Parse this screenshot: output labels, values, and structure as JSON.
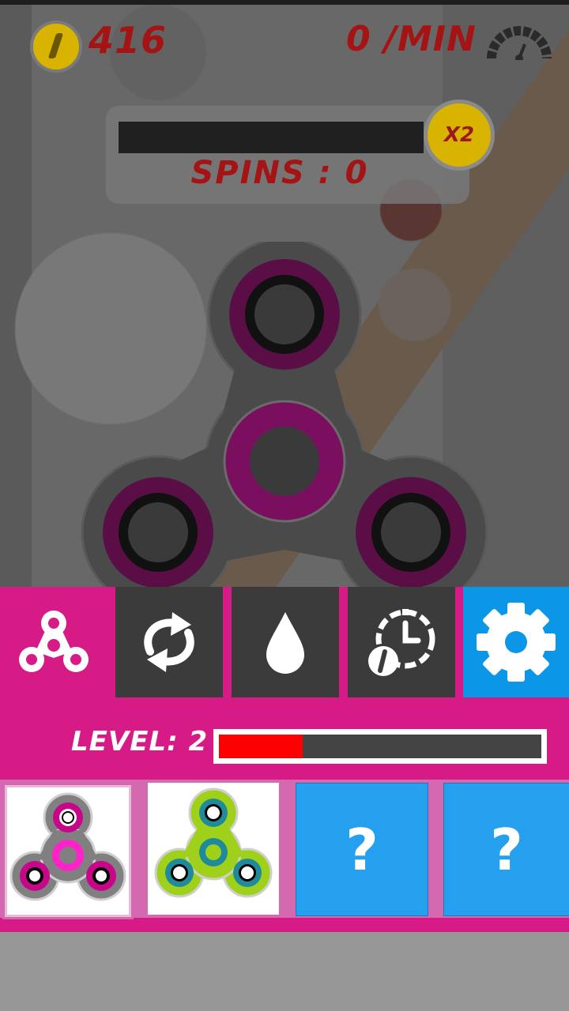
{
  "hud": {
    "coins": "416",
    "spin_rate": "0 /MIN",
    "multiplier": "X2",
    "spins_label": "SPINS : 0"
  },
  "toolbar": {
    "tabs": [
      {
        "name": "spinners",
        "icon": "fidget-spinner-icon"
      },
      {
        "name": "refresh",
        "icon": "refresh-arrows-icon"
      },
      {
        "name": "oil",
        "icon": "drop-icon"
      },
      {
        "name": "boost",
        "icon": "timer-boost-icon"
      },
      {
        "name": "settings",
        "icon": "gear-icon"
      }
    ]
  },
  "level": {
    "label": "LEVEL: 2",
    "progress": 0.26
  },
  "cards": [
    {
      "type": "spinner",
      "state": "selected",
      "body_color": "#808080",
      "ring_color": "#c7068a"
    },
    {
      "type": "spinner",
      "state": "owned",
      "body_color": "#9fd11a",
      "ring_color": "#1f8a9a"
    },
    {
      "type": "locked",
      "label": "?"
    },
    {
      "type": "locked",
      "label": "?"
    }
  ],
  "colors": {
    "accent": "#d61a86",
    "settings_blue": "#0b96e8",
    "locked_blue": "#25a0ef",
    "level_fill": "#ff0000",
    "text_red": "#a51414"
  }
}
